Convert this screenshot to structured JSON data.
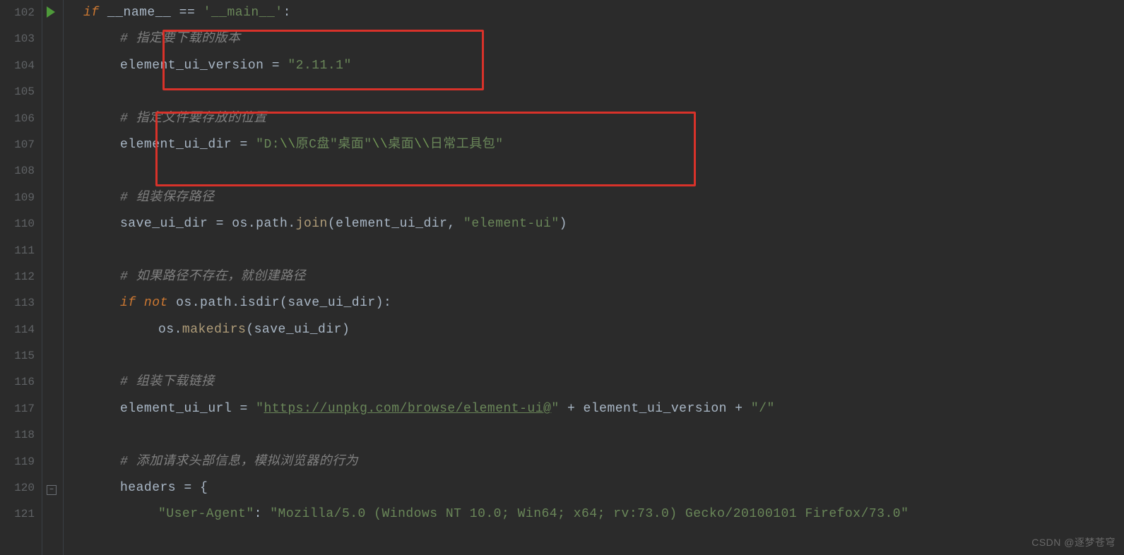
{
  "gutter": {
    "start": 102,
    "end": 121
  },
  "code": {
    "l102": {
      "if": "if",
      "name": "__name__",
      "eq": " == ",
      "main": "'__main__'",
      "colon": ":"
    },
    "l103": {
      "hash": "# ",
      "text": "指定要下载的版本"
    },
    "l104": {
      "var": "element_ui_version",
      "eq": " = ",
      "str": "\"2.11.1\""
    },
    "l106": {
      "hash": "# ",
      "text": "指定文件要存放的位置"
    },
    "l107": {
      "var": "element_ui_dir",
      "eq": " = ",
      "q1": "\"D:",
      "e1": "\\\\",
      "p1": "原C盘\"桌面\"",
      "e2": "\\\\",
      "p2": "桌面",
      "e3": "\\\\",
      "p3": "日常工具包\""
    },
    "l109": {
      "hash": "# ",
      "text": "组装保存路径"
    },
    "l110": {
      "var": "save_ui_dir",
      "eq": " = os.path.",
      "join": "join",
      "args": "(element_ui_dir, ",
      "str": "\"element-ui\"",
      "close": ")"
    },
    "l112": {
      "hash": "# ",
      "text": "如果路径不存在，就创建路径"
    },
    "l113": {
      "if": "if ",
      "not": "not ",
      "call": "os.path.isdir(save_ui_dir):"
    },
    "l114": {
      "pre": "os.",
      "make": "makedirs",
      "args": "(save_ui_dir)"
    },
    "l116": {
      "hash": "# ",
      "text": "组装下载链接"
    },
    "l117": {
      "var": "element_ui_url",
      "eq": " = ",
      "q": "\"",
      "url": "https://unpkg.com/browse/element-ui@",
      "q2": "\"",
      "plus1": " + element_ui_version + ",
      "slash": "\"/\""
    },
    "l119": {
      "hash": "# ",
      "text": "添加请求头部信息，模拟浏览器的行为"
    },
    "l120": {
      "var": "headers",
      "eq": " = {"
    },
    "l121": {
      "key": "\"User-Agent\"",
      "colon": ": ",
      "val": "\"Mozilla/5.0 (Windows NT 10.0; Win64; x64; rv:73.0) Gecko/20100101 Firefox/73.0\""
    }
  },
  "watermark": "CSDN @逐梦苍穹"
}
